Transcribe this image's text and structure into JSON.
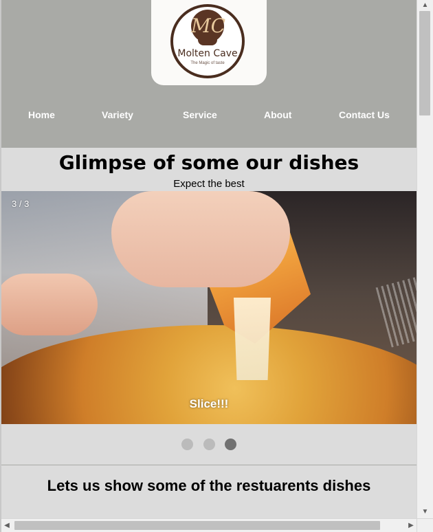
{
  "brand": {
    "name": "Molten Cave",
    "tagline": "The Magic of taste",
    "monogram": "MC"
  },
  "nav": {
    "items": [
      {
        "label": "Home"
      },
      {
        "label": "Variety"
      },
      {
        "label": "Service"
      },
      {
        "label": "About"
      },
      {
        "label": "Contact Us"
      }
    ]
  },
  "gallery": {
    "title": "Glimpse of some our dishes",
    "subtitle": "Expect the best",
    "counter": "3 / 3",
    "caption": "Slice!!!",
    "dots_count": 3,
    "active_dot": 3
  },
  "dishes": {
    "title": "Lets us show some of the restuarents dishes"
  },
  "colors": {
    "header_bg": "#a9aaa6",
    "page_bg": "#dcdcdc",
    "logo_brown": "#4a2d1f",
    "dot_active": "#717171",
    "dot_inactive": "#bbbbbb"
  },
  "icons": {
    "scroll_up": "chevron-up-icon",
    "scroll_down": "chevron-down-icon",
    "scroll_left": "chevron-left-icon",
    "scroll_right": "chevron-right-icon"
  }
}
